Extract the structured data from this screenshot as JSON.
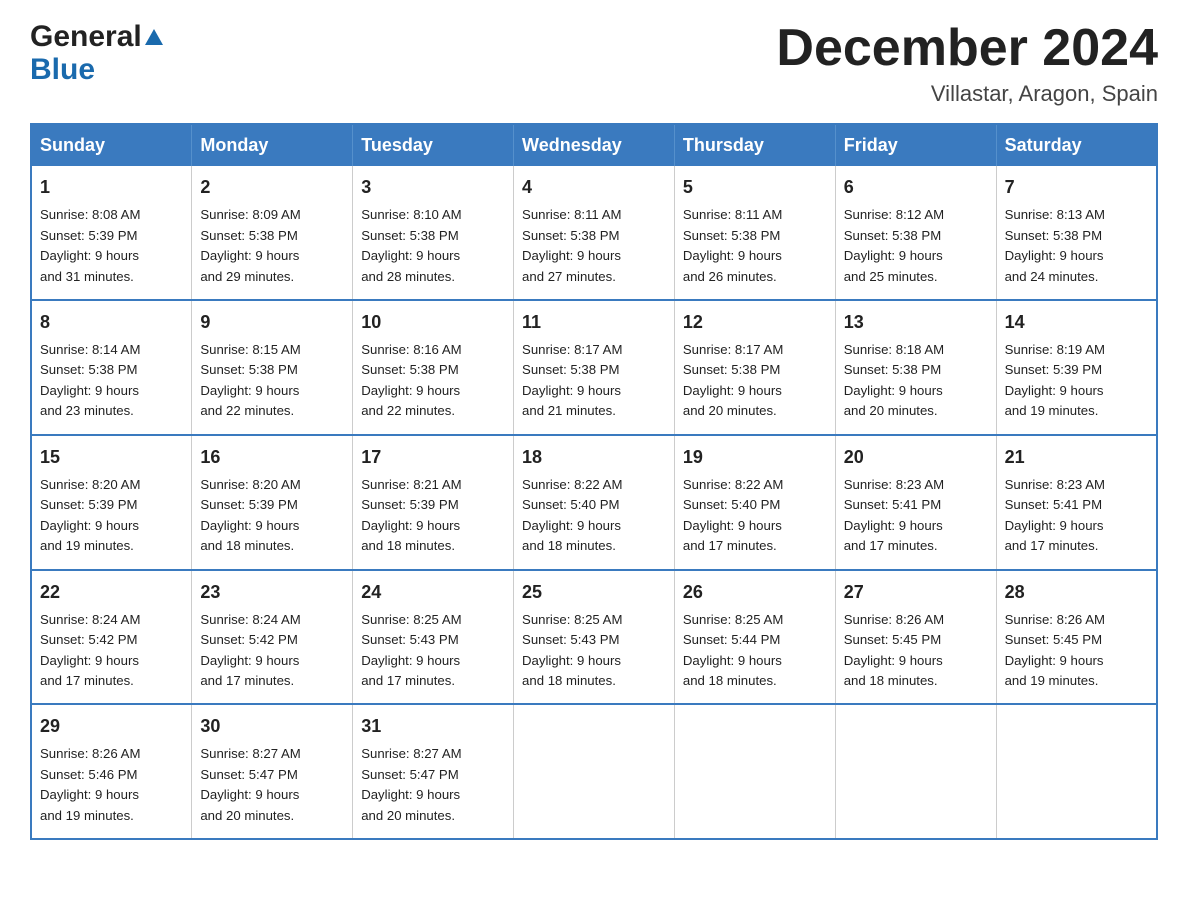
{
  "header": {
    "logo_general": "General",
    "logo_blue": "Blue",
    "month_title": "December 2024",
    "location": "Villastar, Aragon, Spain"
  },
  "days_of_week": [
    "Sunday",
    "Monday",
    "Tuesday",
    "Wednesday",
    "Thursday",
    "Friday",
    "Saturday"
  ],
  "weeks": [
    [
      {
        "num": "1",
        "sunrise": "8:08 AM",
        "sunset": "5:39 PM",
        "daylight": "9 hours and 31 minutes."
      },
      {
        "num": "2",
        "sunrise": "8:09 AM",
        "sunset": "5:38 PM",
        "daylight": "9 hours and 29 minutes."
      },
      {
        "num": "3",
        "sunrise": "8:10 AM",
        "sunset": "5:38 PM",
        "daylight": "9 hours and 28 minutes."
      },
      {
        "num": "4",
        "sunrise": "8:11 AM",
        "sunset": "5:38 PM",
        "daylight": "9 hours and 27 minutes."
      },
      {
        "num": "5",
        "sunrise": "8:11 AM",
        "sunset": "5:38 PM",
        "daylight": "9 hours and 26 minutes."
      },
      {
        "num": "6",
        "sunrise": "8:12 AM",
        "sunset": "5:38 PM",
        "daylight": "9 hours and 25 minutes."
      },
      {
        "num": "7",
        "sunrise": "8:13 AM",
        "sunset": "5:38 PM",
        "daylight": "9 hours and 24 minutes."
      }
    ],
    [
      {
        "num": "8",
        "sunrise": "8:14 AM",
        "sunset": "5:38 PM",
        "daylight": "9 hours and 23 minutes."
      },
      {
        "num": "9",
        "sunrise": "8:15 AM",
        "sunset": "5:38 PM",
        "daylight": "9 hours and 22 minutes."
      },
      {
        "num": "10",
        "sunrise": "8:16 AM",
        "sunset": "5:38 PM",
        "daylight": "9 hours and 22 minutes."
      },
      {
        "num": "11",
        "sunrise": "8:17 AM",
        "sunset": "5:38 PM",
        "daylight": "9 hours and 21 minutes."
      },
      {
        "num": "12",
        "sunrise": "8:17 AM",
        "sunset": "5:38 PM",
        "daylight": "9 hours and 20 minutes."
      },
      {
        "num": "13",
        "sunrise": "8:18 AM",
        "sunset": "5:38 PM",
        "daylight": "9 hours and 20 minutes."
      },
      {
        "num": "14",
        "sunrise": "8:19 AM",
        "sunset": "5:39 PM",
        "daylight": "9 hours and 19 minutes."
      }
    ],
    [
      {
        "num": "15",
        "sunrise": "8:20 AM",
        "sunset": "5:39 PM",
        "daylight": "9 hours and 19 minutes."
      },
      {
        "num": "16",
        "sunrise": "8:20 AM",
        "sunset": "5:39 PM",
        "daylight": "9 hours and 18 minutes."
      },
      {
        "num": "17",
        "sunrise": "8:21 AM",
        "sunset": "5:39 PM",
        "daylight": "9 hours and 18 minutes."
      },
      {
        "num": "18",
        "sunrise": "8:22 AM",
        "sunset": "5:40 PM",
        "daylight": "9 hours and 18 minutes."
      },
      {
        "num": "19",
        "sunrise": "8:22 AM",
        "sunset": "5:40 PM",
        "daylight": "9 hours and 17 minutes."
      },
      {
        "num": "20",
        "sunrise": "8:23 AM",
        "sunset": "5:41 PM",
        "daylight": "9 hours and 17 minutes."
      },
      {
        "num": "21",
        "sunrise": "8:23 AM",
        "sunset": "5:41 PM",
        "daylight": "9 hours and 17 minutes."
      }
    ],
    [
      {
        "num": "22",
        "sunrise": "8:24 AM",
        "sunset": "5:42 PM",
        "daylight": "9 hours and 17 minutes."
      },
      {
        "num": "23",
        "sunrise": "8:24 AM",
        "sunset": "5:42 PM",
        "daylight": "9 hours and 17 minutes."
      },
      {
        "num": "24",
        "sunrise": "8:25 AM",
        "sunset": "5:43 PM",
        "daylight": "9 hours and 17 minutes."
      },
      {
        "num": "25",
        "sunrise": "8:25 AM",
        "sunset": "5:43 PM",
        "daylight": "9 hours and 18 minutes."
      },
      {
        "num": "26",
        "sunrise": "8:25 AM",
        "sunset": "5:44 PM",
        "daylight": "9 hours and 18 minutes."
      },
      {
        "num": "27",
        "sunrise": "8:26 AM",
        "sunset": "5:45 PM",
        "daylight": "9 hours and 18 minutes."
      },
      {
        "num": "28",
        "sunrise": "8:26 AM",
        "sunset": "5:45 PM",
        "daylight": "9 hours and 19 minutes."
      }
    ],
    [
      {
        "num": "29",
        "sunrise": "8:26 AM",
        "sunset": "5:46 PM",
        "daylight": "9 hours and 19 minutes."
      },
      {
        "num": "30",
        "sunrise": "8:27 AM",
        "sunset": "5:47 PM",
        "daylight": "9 hours and 20 minutes."
      },
      {
        "num": "31",
        "sunrise": "8:27 AM",
        "sunset": "5:47 PM",
        "daylight": "9 hours and 20 minutes."
      },
      null,
      null,
      null,
      null
    ]
  ],
  "labels": {
    "sunrise": "Sunrise:",
    "sunset": "Sunset:",
    "daylight": "Daylight:"
  }
}
